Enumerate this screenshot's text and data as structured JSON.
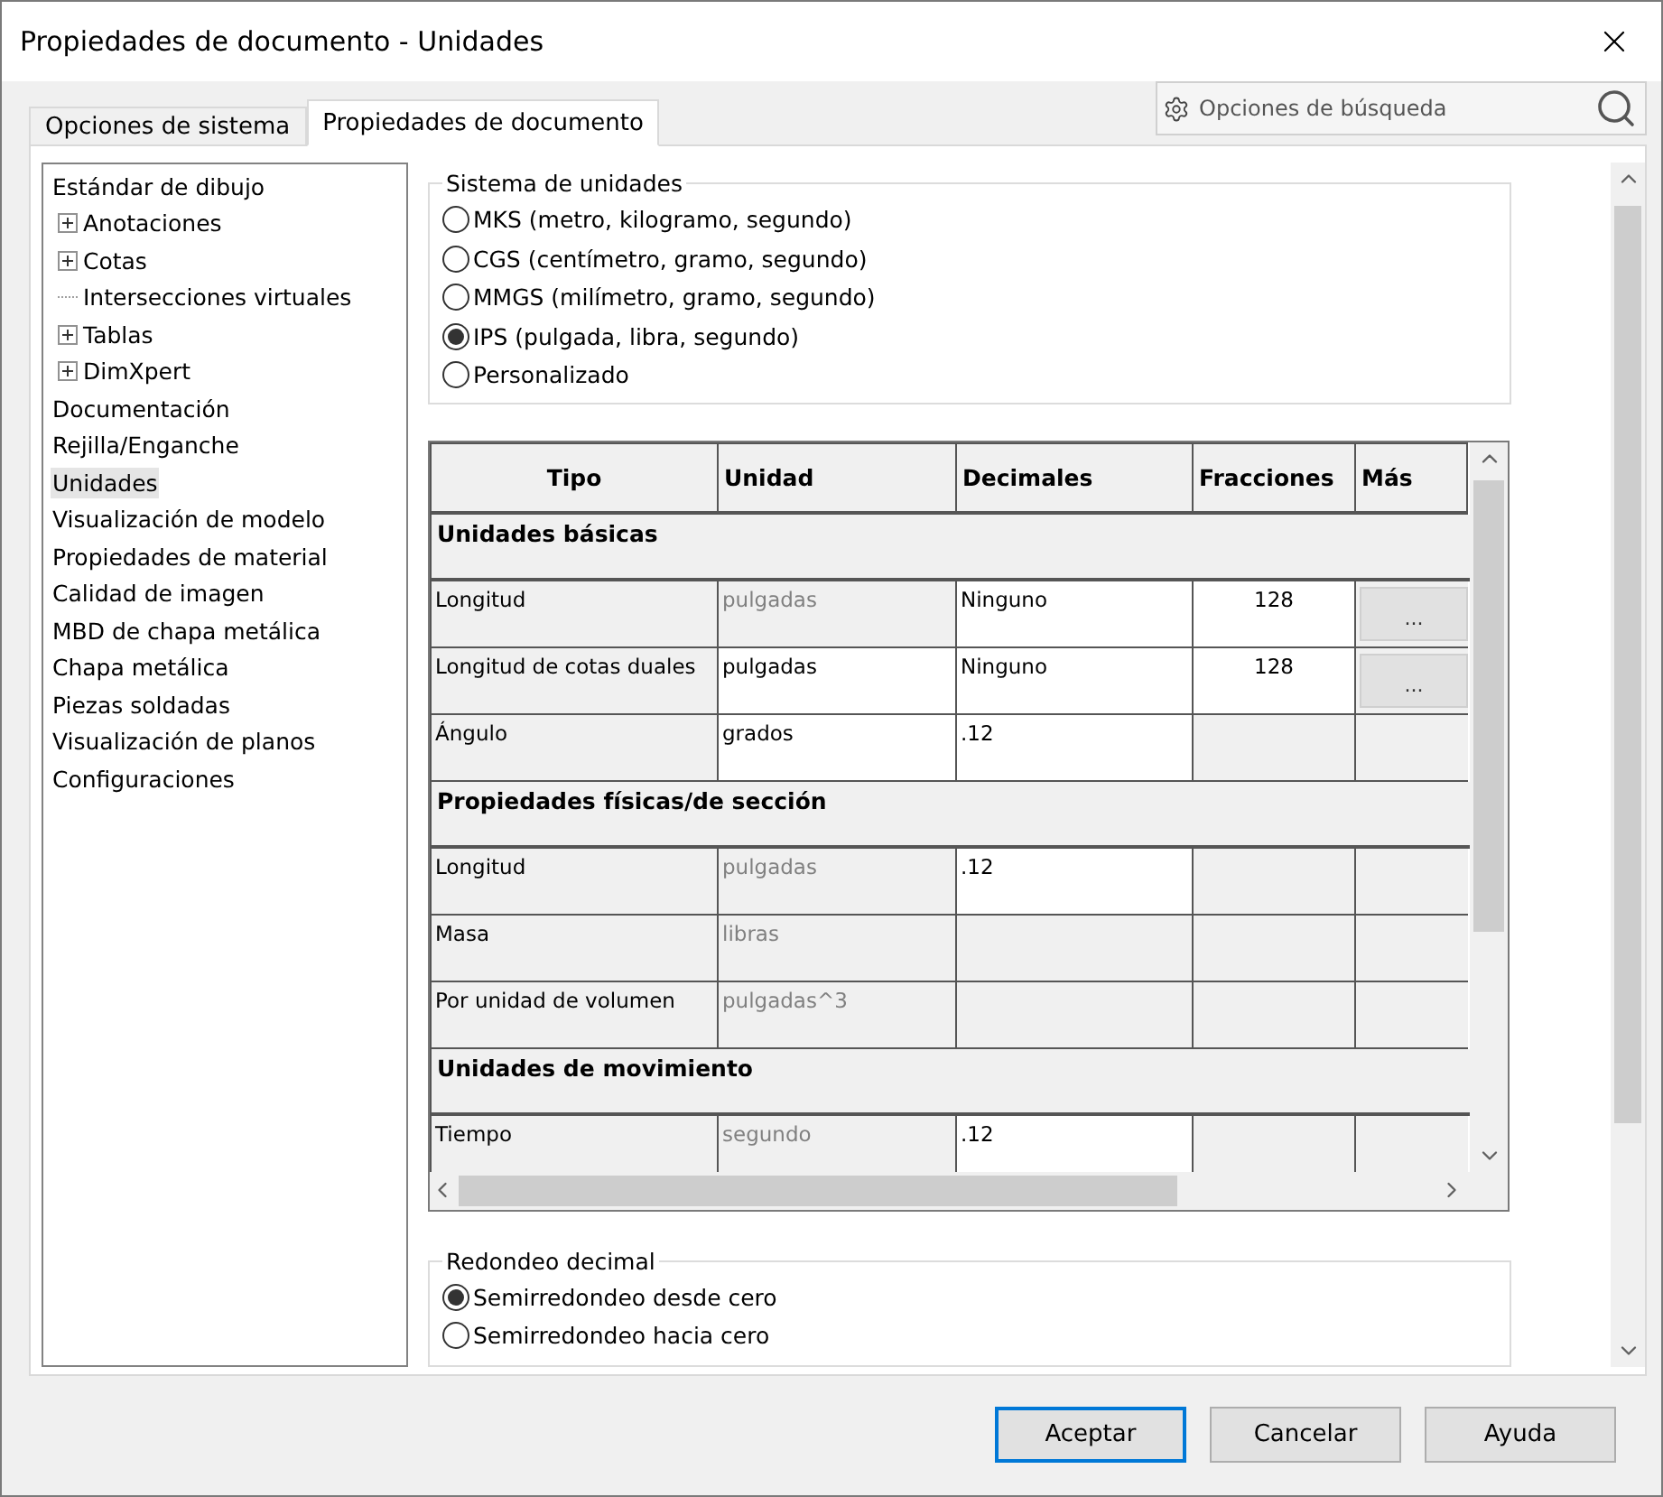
{
  "window": {
    "title": "Propiedades de documento - Unidades"
  },
  "tabs": [
    {
      "label": "Opciones de sistema",
      "selected": false
    },
    {
      "label": "Propiedades de documento",
      "selected": true
    }
  ],
  "search": {
    "placeholder": "Opciones de búsqueda"
  },
  "tree": [
    {
      "label": "Estándar de dibujo",
      "selected": false,
      "children": [
        {
          "label": "Anotaciones",
          "selected": false,
          "expanded": false
        },
        {
          "label": "Cotas",
          "selected": false,
          "expanded": false
        },
        {
          "label": "Intersecciones virtuales",
          "selected": false
        },
        {
          "label": "Tablas",
          "selected": false,
          "expanded": false
        },
        {
          "label": "DimXpert",
          "selected": false,
          "expanded": false
        }
      ]
    },
    {
      "label": "Documentación",
      "selected": false
    },
    {
      "label": "Rejilla/Enganche",
      "selected": false
    },
    {
      "label": "Unidades",
      "selected": true
    },
    {
      "label": "Visualización de modelo",
      "selected": false
    },
    {
      "label": "Propiedades de material",
      "selected": false
    },
    {
      "label": "Calidad de imagen",
      "selected": false
    },
    {
      "label": "MBD de chapa metálica",
      "selected": false
    },
    {
      "label": "Chapa metálica",
      "selected": false
    },
    {
      "label": "Piezas soldadas",
      "selected": false
    },
    {
      "label": "Visualización de planos",
      "selected": false
    },
    {
      "label": "Configuraciones",
      "selected": false
    }
  ],
  "unit_system": {
    "title": "Sistema de unidades",
    "options": [
      {
        "label": "MKS (metro, kilogramo, segundo)",
        "selected": false
      },
      {
        "label": "CGS (centímetro, gramo, segundo)",
        "selected": false
      },
      {
        "label": "MMGS (milímetro, gramo, segundo)",
        "selected": false
      },
      {
        "label": "IPS (pulgada, libra, segundo)",
        "selected": true
      },
      {
        "label": "Personalizado",
        "selected": false
      }
    ]
  },
  "table": {
    "columns": [
      "Tipo",
      "Unidad",
      "Decimales",
      "Fracciones",
      "Más"
    ],
    "rows": [
      {
        "kind": "section",
        "label": "Unidades básicas"
      },
      {
        "kind": "row",
        "cells": [
          {
            "text": "Longitud",
            "editable": false,
            "dimmed": false
          },
          {
            "text": "pulgadas",
            "editable": false,
            "dimmed": true
          },
          {
            "text": "Ninguno",
            "editable": true,
            "dimmed": false
          },
          {
            "text": "128",
            "editable": true,
            "dimmed": false
          }
        ],
        "more": "..."
      },
      {
        "kind": "row",
        "cells": [
          {
            "text": "Longitud de cotas duales",
            "editable": false,
            "dimmed": false
          },
          {
            "text": "pulgadas",
            "editable": true,
            "dimmed": false
          },
          {
            "text": "Ninguno",
            "editable": true,
            "dimmed": false
          },
          {
            "text": "128",
            "editable": true,
            "dimmed": false
          }
        ],
        "more": "..."
      },
      {
        "kind": "row",
        "cells": [
          {
            "text": "Ángulo",
            "editable": false,
            "dimmed": false
          },
          {
            "text": "grados",
            "editable": true,
            "dimmed": false
          },
          {
            "text": ".12",
            "editable": true,
            "dimmed": false
          },
          {
            "editable": false
          }
        ]
      },
      {
        "kind": "section",
        "label": "Propiedades físicas/de sección"
      },
      {
        "kind": "row",
        "cells": [
          {
            "text": "Longitud",
            "editable": false,
            "dimmed": false
          },
          {
            "text": "pulgadas",
            "editable": false,
            "dimmed": true
          },
          {
            "text": ".12",
            "editable": true,
            "dimmed": false
          },
          {
            "editable": false
          }
        ]
      },
      {
        "kind": "row",
        "cells": [
          {
            "text": "Masa",
            "editable": false,
            "dimmed": false
          },
          {
            "text": "libras",
            "editable": false,
            "dimmed": true
          },
          {
            "editable": false
          },
          {
            "editable": false
          }
        ]
      },
      {
        "kind": "row",
        "cells": [
          {
            "text": "Por unidad de volumen",
            "editable": false,
            "dimmed": false
          },
          {
            "text": "pulgadas^3",
            "editable": false,
            "dimmed": true
          },
          {
            "editable": false
          },
          {
            "editable": false
          }
        ]
      },
      {
        "kind": "section",
        "label": "Unidades de movimiento"
      },
      {
        "kind": "row",
        "cells": [
          {
            "text": "Tiempo",
            "editable": false,
            "dimmed": false
          },
          {
            "text": "segundo",
            "editable": false,
            "dimmed": true
          },
          {
            "text": ".12",
            "editable": true,
            "dimmed": false
          },
          {
            "editable": false
          }
        ]
      }
    ]
  },
  "rounding": {
    "title": "Redondeo decimal",
    "options": [
      {
        "label": "Semirredondeo desde cero",
        "selected": true
      },
      {
        "label": "Semirredondeo hacia cero",
        "selected": false
      }
    ]
  },
  "buttons": [
    {
      "label": "Aceptar",
      "default": true
    },
    {
      "label": "Cancelar",
      "default": false
    },
    {
      "label": "Ayuda",
      "default": false
    }
  ]
}
